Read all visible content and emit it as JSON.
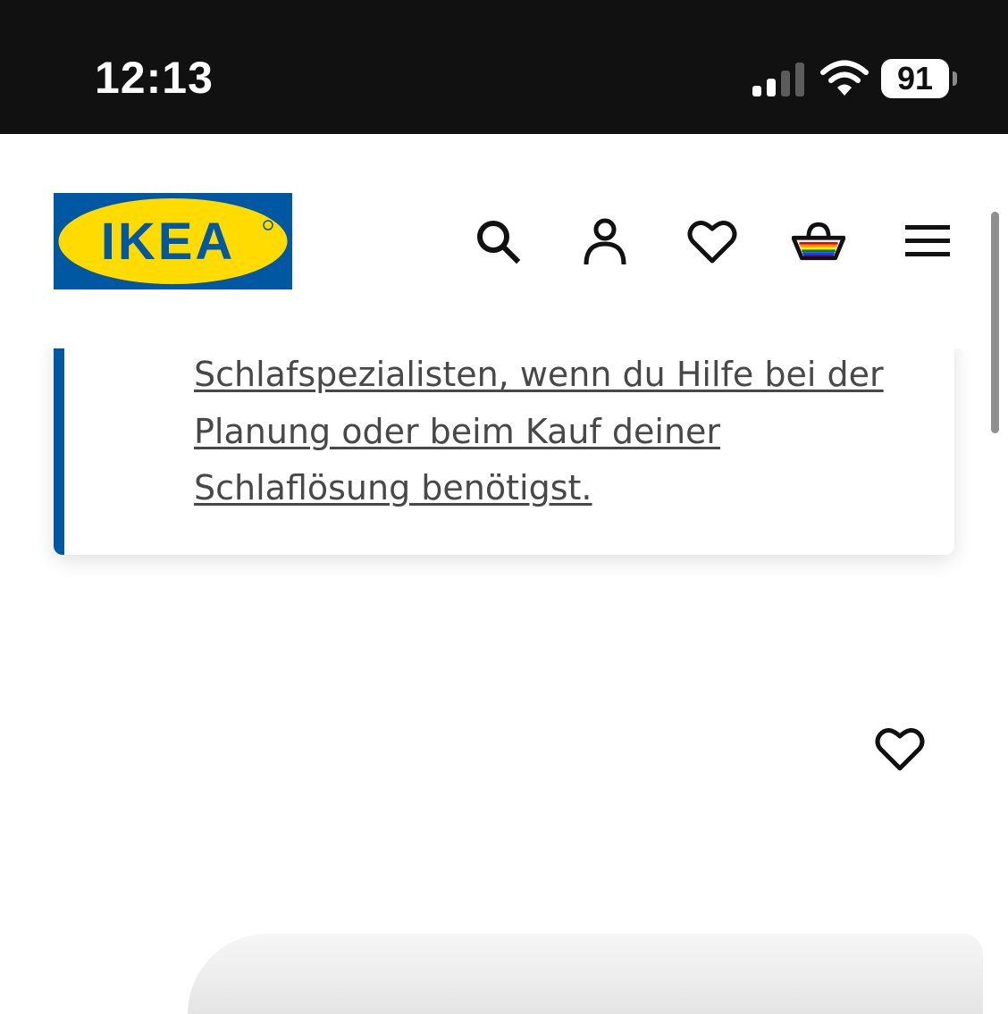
{
  "status_bar": {
    "time": "12:13",
    "battery_level": "91",
    "signal_bars_active": 2,
    "signal_bars_total": 4
  },
  "header": {
    "logo_text": "IKEA",
    "icons": [
      "search-icon",
      "user-icon",
      "heart-icon",
      "basket-icon",
      "menu-icon"
    ]
  },
  "info_card": {
    "lines": [
      "Schlafspezialisten, wenn du Hilfe bei der",
      "Planung oder beim Kauf deiner",
      "Schlaflösung benötigst."
    ]
  },
  "colors": {
    "ikea_blue": "#0058a3",
    "ikea_yellow": "#ffdb00",
    "status_bar_bg": "#111111",
    "link_text": "#484848"
  }
}
